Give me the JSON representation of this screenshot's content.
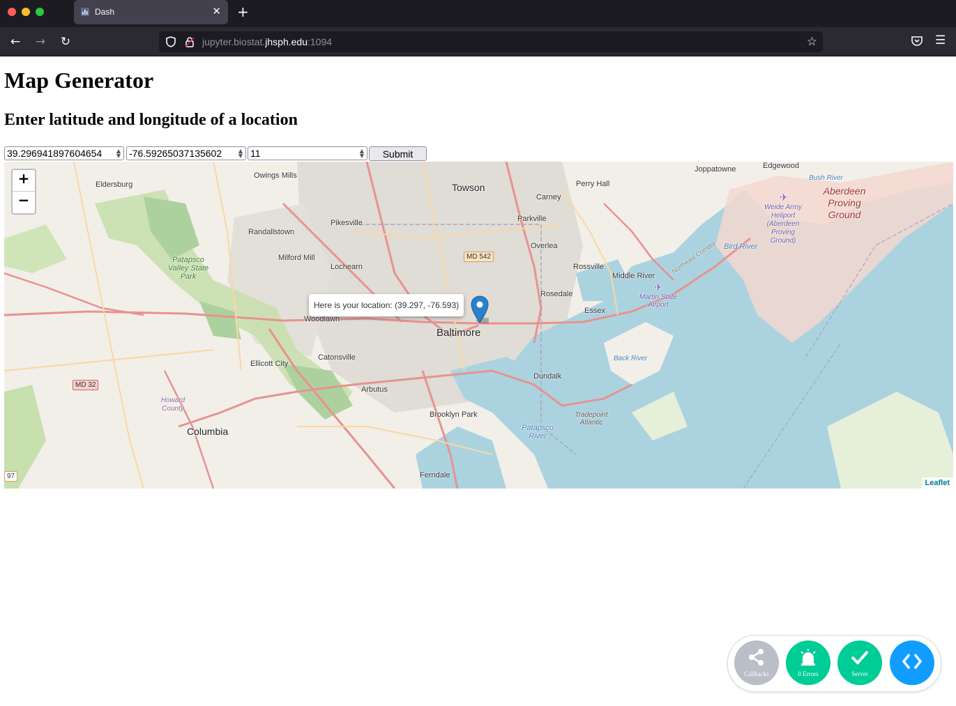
{
  "browser": {
    "tab_title": "Dash",
    "url_prefix": "jupyter.biostat.",
    "url_host": "jhsph.edu",
    "url_suffix": ":1094"
  },
  "page": {
    "title": "Map Generator",
    "subtitle": "Enter latitude and longitude of a location"
  },
  "form": {
    "latitude": "39.296941897604654",
    "longitude": "-76.59265037135602",
    "zoom": "11",
    "submit_label": "Submit"
  },
  "map": {
    "popup_text": "Here is your location: (39.297, -76.593)",
    "attribution": "Leaflet",
    "zoom_in": "+",
    "zoom_out": "−",
    "labels": {
      "baltimore": "Baltimore",
      "towson": "Towson",
      "columbia": "Columbia",
      "eldersburg": "Eldersburg",
      "owings_mills": "Owings Mills",
      "pikesville": "Pikesville",
      "randallstown": "Randallstown",
      "milford_mill": "Milford Mill",
      "lochearn": "Lochearn",
      "woodlawn": "Woodlawn",
      "catonsville": "Catonsville",
      "ellicott_city": "Ellicott City",
      "arbutus": "Arbutus",
      "brooklyn_park": "Brooklyn Park",
      "ferndale": "Ferndale",
      "dundalk": "Dundalk",
      "essex": "Essex",
      "rosedale": "Rosedale",
      "rossville": "Rossville",
      "middle_river": "Middle River",
      "overlea": "Overlea",
      "parkville": "Parkville",
      "carney": "Carney",
      "perry_hall": "Perry Hall",
      "joppatowne": "Joppatowne",
      "edgewood": "Edgewood",
      "aberdeen": "Aberdeen Proving Ground",
      "weide": "Weide Army Heliport (Aberdeen Proving Ground)",
      "bush_river": "Bush River",
      "bird_river": "Bird River",
      "back_river": "Back River",
      "patapsco_river": "Patapsco River",
      "patapsco_park": "Patapsco Valley State Park",
      "martin_airport": "Martin State Airport",
      "howard_county": "Howard County",
      "tradepoint": "Tradepoint Atlantic",
      "northeast_corridor": "Northeast Corridor",
      "md542": "MD 542",
      "md32": "MD 32",
      "r97": "97"
    }
  },
  "devtools": {
    "callbacks_label": "Callbacks",
    "errors_label": "0 Errors",
    "server_label": "Server"
  },
  "colors": {
    "dash_green": "#00cc96",
    "dash_blue": "#119dff",
    "dash_grey": "#b9bec7",
    "marker_blue": "#2a81cb",
    "water": "#aad3df"
  }
}
